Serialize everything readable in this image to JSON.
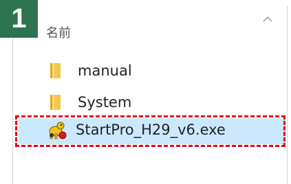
{
  "step": {
    "number": "1",
    "color": "#2d7350"
  },
  "column_header": {
    "label": "名前",
    "sort_icon": "chevron-up-icon"
  },
  "files": [
    {
      "name": "manual",
      "type": "folder",
      "icon": "folder-icon"
    },
    {
      "name": "System",
      "type": "folder",
      "icon": "folder-icon"
    },
    {
      "name": "StartPro_H29_v6.exe",
      "type": "executable",
      "icon": "app-icon",
      "selected": true
    }
  ],
  "colors": {
    "selection_bg": "#cce8ff",
    "highlight_border": "#e8000b",
    "folder_yellow": "#f4c84a"
  }
}
